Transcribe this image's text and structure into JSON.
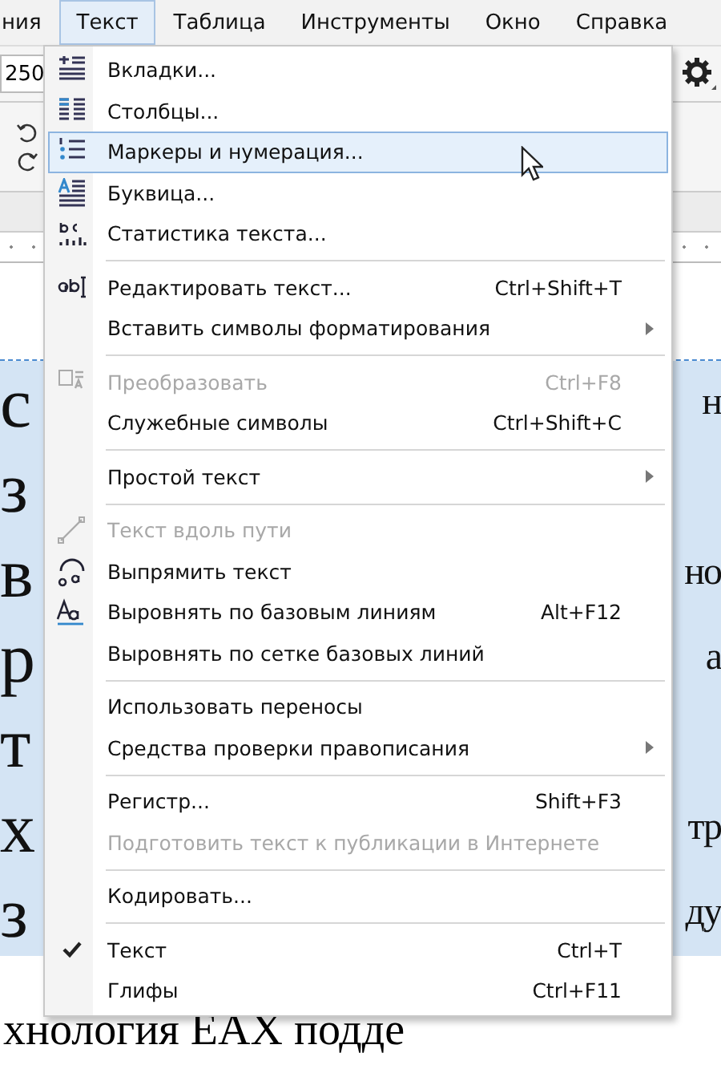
{
  "menubar": [
    {
      "label": "ния",
      "selected": false
    },
    {
      "label": "Текст",
      "selected": true
    },
    {
      "label": "Таблица",
      "selected": false
    },
    {
      "label": "Инструменты",
      "selected": false
    },
    {
      "label": "Окно",
      "selected": false
    },
    {
      "label": "Справка",
      "selected": false
    }
  ],
  "toolbar": {
    "size_field": "250"
  },
  "document": {
    "lines": [
      {
        "left": "с",
        "right": "н",
        "highlighted": true
      },
      {
        "left": "з",
        "highlighted": true
      },
      {
        "left": "в",
        "right": "но",
        "highlighted": true
      },
      {
        "left": "р",
        "right": "а",
        "highlighted": true
      },
      {
        "left": "т",
        "highlighted": true
      },
      {
        "left": "х",
        "right": "тр",
        "highlighted": true
      },
      {
        "left": "з",
        "right": "ду",
        "highlighted": true
      }
    ],
    "last_line": "хнология EAX подде"
  },
  "menu": {
    "items": [
      {
        "kind": "item",
        "label": "Вкладки...",
        "submenu": false,
        "disabled": false,
        "checked": false,
        "selected": false
      },
      {
        "kind": "item",
        "label": "Столбцы...",
        "submenu": false,
        "disabled": false,
        "checked": false,
        "selected": false
      },
      {
        "kind": "item",
        "label": "Маркеры и нумерация...",
        "submenu": false,
        "disabled": false,
        "checked": false,
        "selected": true
      },
      {
        "kind": "item",
        "label": "Буквица...",
        "submenu": false,
        "disabled": false,
        "checked": false,
        "selected": false
      },
      {
        "kind": "item",
        "label": "Статистика текста...",
        "submenu": false,
        "disabled": false,
        "checked": false,
        "selected": false
      },
      {
        "kind": "separator"
      },
      {
        "kind": "item",
        "label": "Редактировать текст...",
        "shortcut": "Ctrl+Shift+T",
        "submenu": false,
        "disabled": false,
        "checked": false,
        "selected": false
      },
      {
        "kind": "item",
        "label": "Вставить символы форматирования",
        "submenu": true,
        "disabled": false,
        "checked": false,
        "selected": false
      },
      {
        "kind": "separator"
      },
      {
        "kind": "item",
        "label": "Преобразовать",
        "shortcut": "Ctrl+F8",
        "submenu": false,
        "disabled": true,
        "checked": false,
        "selected": false
      },
      {
        "kind": "item",
        "label": "Служебные символы",
        "shortcut": "Ctrl+Shift+C",
        "submenu": false,
        "disabled": false,
        "checked": false,
        "selected": false
      },
      {
        "kind": "separator"
      },
      {
        "kind": "item",
        "label": "Простой текст",
        "submenu": true,
        "disabled": false,
        "checked": false,
        "selected": false
      },
      {
        "kind": "separator"
      },
      {
        "kind": "item",
        "label": "Текст вдоль пути",
        "submenu": false,
        "disabled": true,
        "checked": false,
        "selected": false
      },
      {
        "kind": "item",
        "label": "Выпрямить текст",
        "submenu": false,
        "disabled": false,
        "checked": false,
        "selected": false
      },
      {
        "kind": "item",
        "label": "Выровнять по базовым линиям",
        "shortcut": "Alt+F12",
        "submenu": false,
        "disabled": false,
        "checked": false,
        "selected": false
      },
      {
        "kind": "item",
        "label": "Выровнять по сетке базовых линий",
        "submenu": false,
        "disabled": false,
        "checked": false,
        "selected": false
      },
      {
        "kind": "separator"
      },
      {
        "kind": "item",
        "label": "Использовать переносы",
        "submenu": false,
        "disabled": false,
        "checked": false,
        "selected": false
      },
      {
        "kind": "item",
        "label": "Средства проверки правописания",
        "submenu": true,
        "disabled": false,
        "checked": false,
        "selected": false
      },
      {
        "kind": "separator"
      },
      {
        "kind": "item",
        "label": "Регистр...",
        "shortcut": "Shift+F3",
        "submenu": false,
        "disabled": false,
        "checked": false,
        "selected": false
      },
      {
        "kind": "item",
        "label": "Подготовить текст к публикации в Интернете",
        "submenu": false,
        "disabled": true,
        "checked": false,
        "selected": false
      },
      {
        "kind": "separator"
      },
      {
        "kind": "item",
        "label": "Кодировать...",
        "submenu": false,
        "disabled": false,
        "checked": false,
        "selected": false
      },
      {
        "kind": "separator"
      },
      {
        "kind": "item",
        "label": "Текст",
        "shortcut": "Ctrl+T",
        "submenu": false,
        "disabled": false,
        "checked": true,
        "selected": false
      },
      {
        "kind": "item",
        "label": "Глифы",
        "shortcut": "Ctrl+F11",
        "submenu": false,
        "disabled": false,
        "checked": false,
        "selected": false
      }
    ]
  }
}
